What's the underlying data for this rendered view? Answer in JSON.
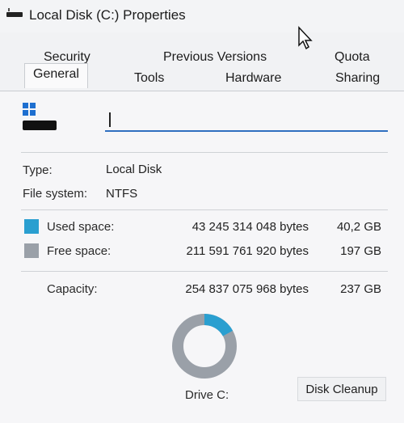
{
  "window": {
    "title": "Local Disk (C:) Properties"
  },
  "tabs": {
    "row1": [
      "Security",
      "Previous Versions",
      "Quota"
    ],
    "row2": [
      "General",
      "Tools",
      "Hardware",
      "Sharing"
    ],
    "active": "General"
  },
  "general": {
    "name_value": "",
    "type_label": "Type:",
    "type_value": "Local Disk",
    "fs_label": "File system:",
    "fs_value": "NTFS",
    "used_label": "Used space:",
    "used_bytes": "43 245 314 048 bytes",
    "used_size": "40,2 GB",
    "free_label": "Free space:",
    "free_bytes": "211 591 761 920 bytes",
    "free_size": "197 GB",
    "capacity_label": "Capacity:",
    "capacity_bytes": "254 837 075 968 bytes",
    "capacity_size": "237 GB",
    "drive_label": "Drive C:",
    "cleanup_label": "Disk Cleanup"
  },
  "usage": {
    "used_fraction": 0.17,
    "used_color": "#2a9fd0",
    "free_color": "#9aa0a8"
  }
}
